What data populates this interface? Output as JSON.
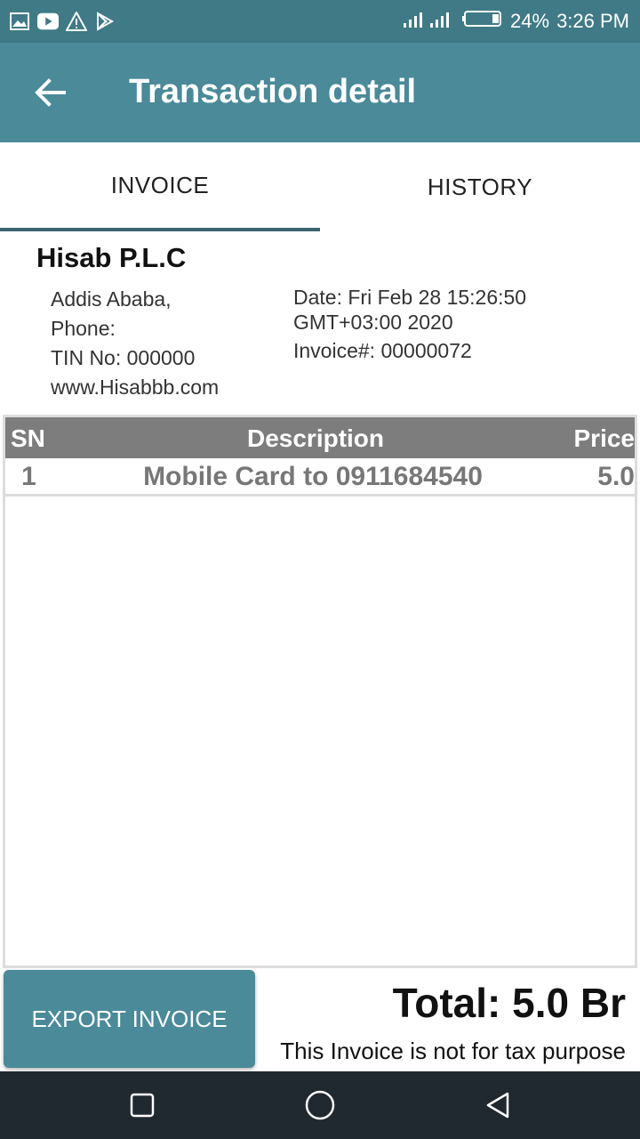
{
  "status_bar": {
    "battery": "24%",
    "time": "3:26 PM",
    "icons": [
      "image-icon",
      "youtube-icon",
      "warning-icon",
      "play-store-icon",
      "signal-icon",
      "battery-icon"
    ]
  },
  "app_bar": {
    "title": "Transaction detail",
    "back_icon": "back-arrow-icon"
  },
  "tabs": [
    {
      "label": "INVOICE",
      "active": true
    },
    {
      "label": "HISTORY",
      "active": false
    }
  ],
  "invoice": {
    "company": "Hisab P.L.C",
    "address_lines": [
      "Addis Ababa,",
      "Phone:",
      "TIN No:  000000",
      "www.Hisabbb.com"
    ],
    "date": "Date: Fri Feb 28 15:26:50 GMT+03:00 2020",
    "invoice_no": "Invoice#: 00000072",
    "table": {
      "headers": [
        "SN",
        "Description",
        "Price"
      ],
      "rows": [
        {
          "sn": "1",
          "description": "Mobile Card to 0911684540",
          "price": "5.0"
        }
      ]
    },
    "total": "Total:  5.0 Br",
    "note": "This Invoice is not for tax purpose"
  },
  "export_button": "EXPORT INVOICE",
  "colors": {
    "status_bar": "#3f7a86",
    "app_bar": "#4a8a99",
    "tab_indicator": "#3d6373",
    "table_header": "#7d7d7d",
    "nav_bar": "#202830"
  }
}
